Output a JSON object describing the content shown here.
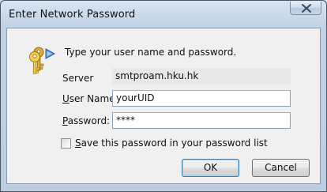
{
  "window": {
    "title": "Enter Network Password",
    "close_icon": "close-icon"
  },
  "prompt": {
    "icon": "key-icon",
    "heading": "Type your user name and password."
  },
  "server": {
    "label": "Server",
    "value": "smtproam.hku.hk"
  },
  "username": {
    "label_mnemonic": "U",
    "label_rest": "ser Name:",
    "value": "yourUID"
  },
  "password": {
    "label_mnemonic": "P",
    "label_rest": "assword:",
    "value": "****"
  },
  "remember": {
    "label_mnemonic": "S",
    "label_rest": "ave this password in your password list",
    "checked": false
  },
  "buttons": {
    "ok": "OK",
    "cancel": "Cancel"
  }
}
